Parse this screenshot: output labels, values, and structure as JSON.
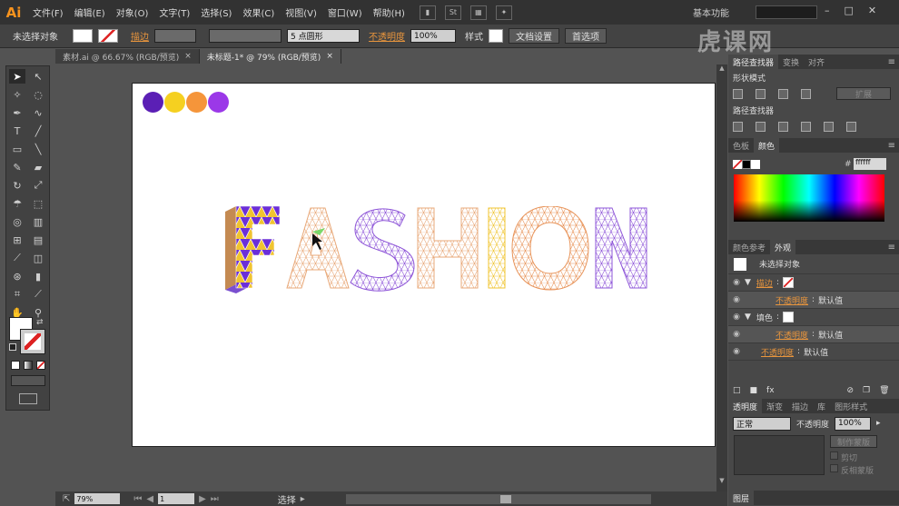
{
  "menu": {
    "app_logo": "Ai",
    "items": [
      "文件(F)",
      "编辑(E)",
      "对象(O)",
      "文字(T)",
      "选择(S)",
      "效果(C)",
      "视图(V)",
      "窗口(W)",
      "帮助(H)"
    ],
    "icon_label": "St",
    "workspace": "基本功能",
    "win_min": "–",
    "win_max": "□",
    "win_close": "✕"
  },
  "control": {
    "no_selection": "未选择对象",
    "stroke": "描边",
    "stroke_weight": "",
    "brush": "",
    "point_shape": "5 点圆形",
    "opacity_label": "不透明度",
    "opacity_value": "100%",
    "style_label": "样式",
    "doc_settings": "文档设置",
    "preferences": "首选项"
  },
  "tabs": [
    {
      "label": "素材.ai @ 66.67% (RGB/预览)",
      "close": "×"
    },
    {
      "label": "未标题-1* @ 79% (RGB/预览)",
      "close": "×"
    }
  ],
  "artboard": {
    "dots": [
      "#5b1fb5",
      "#f5d020",
      "#f5953a",
      "#9b38e8"
    ],
    "fashion_text": "FASHION"
  },
  "status": {
    "zoom": "79%",
    "page": "1",
    "tool": "选择"
  },
  "panels": {
    "pathfinder_tabs": [
      "路径查找器",
      "变换",
      "对齐"
    ],
    "shape_modes": "形状模式",
    "expand": "扩展",
    "pathfinders": "路径查找器",
    "color_tabs": [
      "色板",
      "颜色"
    ],
    "color_hex": "ffffff",
    "appearance_tabs": [
      "颜色参考",
      "外观"
    ],
    "no_selection": "未选择对象",
    "stroke": "描边",
    "opacity": "不透明度",
    "default": "默认值",
    "fill": "填色",
    "transparency_tabs": [
      "透明度",
      "渐变",
      "描边",
      "库",
      "图形样式"
    ],
    "blend_mode": "正常",
    "trans_opacity_label": "不透明度",
    "trans_opacity": "100%",
    "make_mask": "制作蒙版",
    "clip": "剪切",
    "invert_mask": "反相蒙版",
    "layers_tab": "图层"
  },
  "watermark": "虎课网"
}
